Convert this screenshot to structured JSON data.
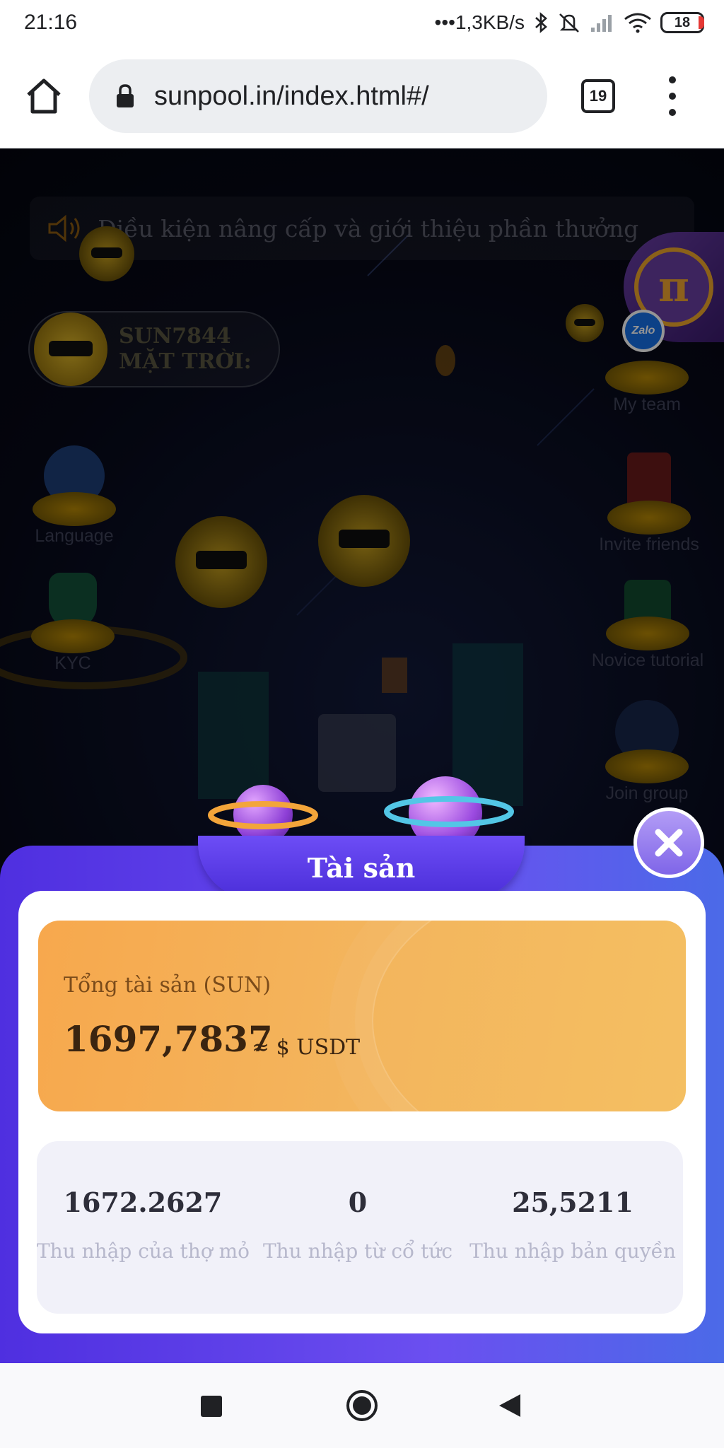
{
  "status_bar": {
    "time": "21:16",
    "network_speed": "•••1,3KB/s",
    "battery": "18",
    "icons": [
      "bluetooth-icon",
      "mute-icon",
      "signal-icon",
      "wifi-icon",
      "battery-icon"
    ]
  },
  "browser": {
    "url": "sunpool.in/index.html#/",
    "tab_count": "19"
  },
  "app": {
    "notice": "Điều kiện nâng cấp và giới thiệu phần thưởng",
    "user_name": "SUN7844",
    "user_subtitle": "MẶT TRỜI:",
    "menu_left": [
      {
        "label": "Language"
      },
      {
        "label": "KYC"
      }
    ],
    "menu_right": [
      {
        "label": "My team"
      },
      {
        "label": "Invite friends"
      },
      {
        "label": "Novice tutorial"
      },
      {
        "label": "Join group"
      }
    ],
    "zalo_label": "Zalo"
  },
  "modal": {
    "title": "Tài sản",
    "total_label": "Tổng tài sản (SUN)",
    "total_value": "1697,7837",
    "total_unit": "≈ $ USDT",
    "income": [
      {
        "value": "1672.2627",
        "label": "Thu nhập của thợ mỏ"
      },
      {
        "value": "0",
        "label": "Thu nhập từ cổ tức"
      },
      {
        "value": "25,5211",
        "label": "Thu nhập bản quyền"
      }
    ]
  },
  "colors": {
    "modal_primary": "#5b3be6",
    "total_card": "#f5b257",
    "accent_gold": "#c9a21f"
  }
}
